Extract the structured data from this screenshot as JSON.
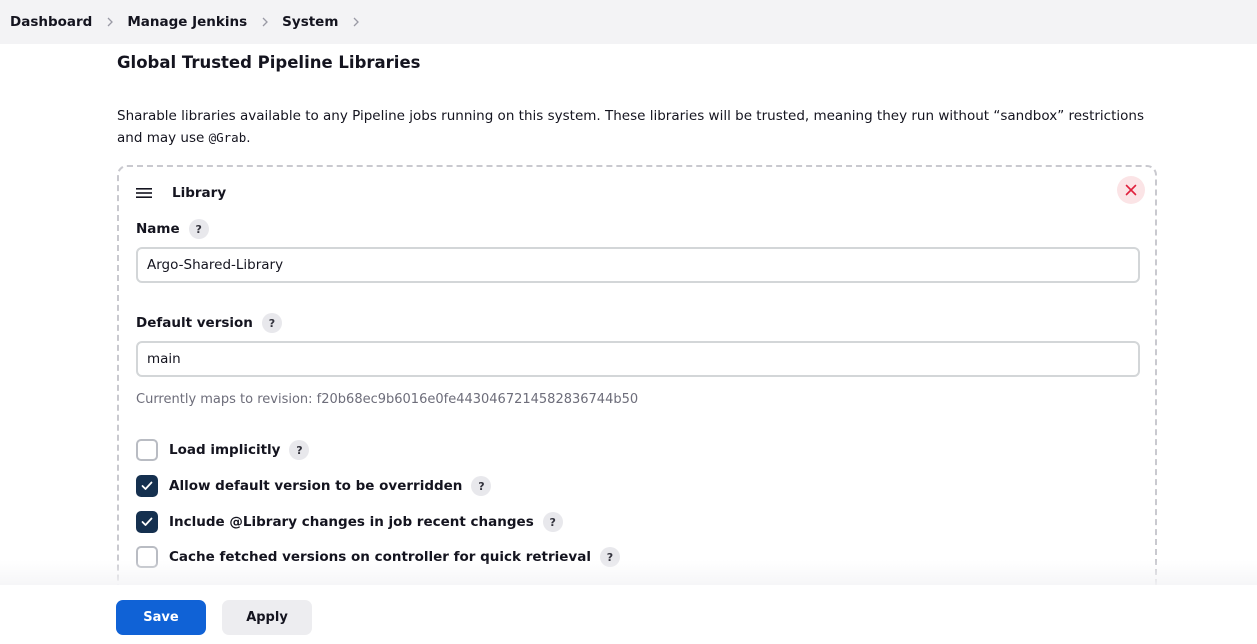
{
  "breadcrumb": {
    "items": [
      "Dashboard",
      "Manage Jenkins",
      "System"
    ]
  },
  "section": {
    "title": "Global Trusted Pipeline Libraries",
    "description_before": "Sharable libraries available to any Pipeline jobs running on this system. These libraries will be trusted, meaning they run without “sandbox” restrictions and may use ",
    "description_code": "@Grab",
    "description_after": "."
  },
  "library": {
    "title": "Library",
    "name_label": "Name",
    "name_value": "Argo-Shared-Library",
    "default_version_label": "Default version",
    "default_version_value": "main",
    "revision_hint": "Currently maps to revision: f20b68ec9b6016e0fe4430467214582836744b50",
    "options": [
      {
        "label": "Load implicitly",
        "checked": false
      },
      {
        "label": "Allow default version to be overridden",
        "checked": true
      },
      {
        "label": "Include @Library changes in job recent changes",
        "checked": true
      },
      {
        "label": "Cache fetched versions on controller for quick retrieval",
        "checked": false
      }
    ],
    "help_glyph": "?"
  },
  "actions": {
    "save_label": "Save",
    "apply_label": "Apply"
  },
  "colors": {
    "primary": "#1062d6",
    "checkbox_checked": "#15304f",
    "danger": "#e0213d"
  }
}
